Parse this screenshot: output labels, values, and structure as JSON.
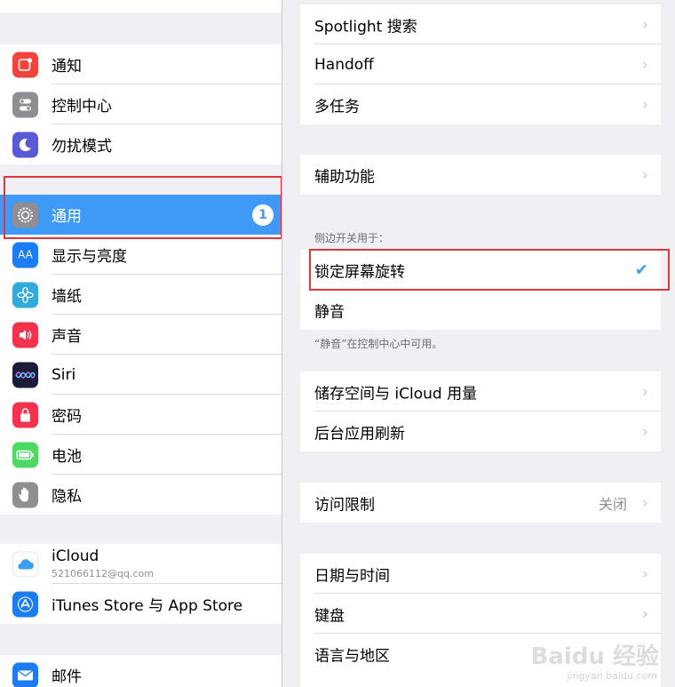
{
  "sidebar": {
    "group1": [
      {
        "label": "通知",
        "icon": "notification-icon",
        "color": "#f2443c"
      },
      {
        "label": "控制中心",
        "icon": "toggles-icon",
        "color": "#8e8e93"
      },
      {
        "label": "勿扰模式",
        "icon": "moon-icon",
        "color": "#5a59d6"
      }
    ],
    "group2": [
      {
        "label": "通用",
        "icon": "gear-icon",
        "color": "#8e8e93",
        "badge": "1",
        "selected": true
      },
      {
        "label": "显示与亮度",
        "icon": "text-size-icon",
        "color": "#1b7cf3"
      },
      {
        "label": "墙纸",
        "icon": "flower-icon",
        "color": "#33aadc"
      },
      {
        "label": "声音",
        "icon": "speaker-icon",
        "color": "#f2334e"
      },
      {
        "label": "Siri",
        "icon": "siri-icon",
        "color": "#1b1b3a"
      },
      {
        "label": "密码",
        "icon": "lock-icon",
        "color": "#f2334e"
      },
      {
        "label": "电池",
        "icon": "battery-icon",
        "color": "#4cd964"
      },
      {
        "label": "隐私",
        "icon": "hand-icon",
        "color": "#8e8e93"
      }
    ],
    "icloud": {
      "label": "iCloud",
      "email": "521066112@qq.com",
      "icon": "cloud-icon",
      "color": "#ffffff"
    },
    "store": {
      "label": "iTunes Store 与 App Store",
      "icon": "app-store-icon",
      "color": "#1b7cf3"
    },
    "mail": {
      "label": "邮件",
      "icon": "mail-icon",
      "color": "#1b7cf3"
    }
  },
  "main": {
    "group1": [
      {
        "label": "Spotlight 搜索"
      },
      {
        "label": "Handoff"
      },
      {
        "label": "多任务"
      }
    ],
    "accessibility": {
      "label": "辅助功能"
    },
    "side_switch": {
      "header": "侧边开关用于：",
      "options": [
        {
          "label": "锁定屏幕旋转",
          "checked": true
        },
        {
          "label": "静音"
        }
      ],
      "footer": "“静音”在控制中心中可用。"
    },
    "group3": [
      {
        "label": "储存空间与 iCloud 用量"
      },
      {
        "label": "后台应用刷新"
      }
    ],
    "restrictions": {
      "label": "访问限制",
      "value": "关闭"
    },
    "group5": [
      {
        "label": "日期与时间"
      },
      {
        "label": "键盘"
      },
      {
        "label": "语言与地区"
      }
    ]
  },
  "watermark": {
    "text": "Baidu 经验",
    "sub": "jingyan.baidu.com"
  },
  "colors": {
    "accent": "#3f9af7",
    "highlight": "#e0353b"
  }
}
